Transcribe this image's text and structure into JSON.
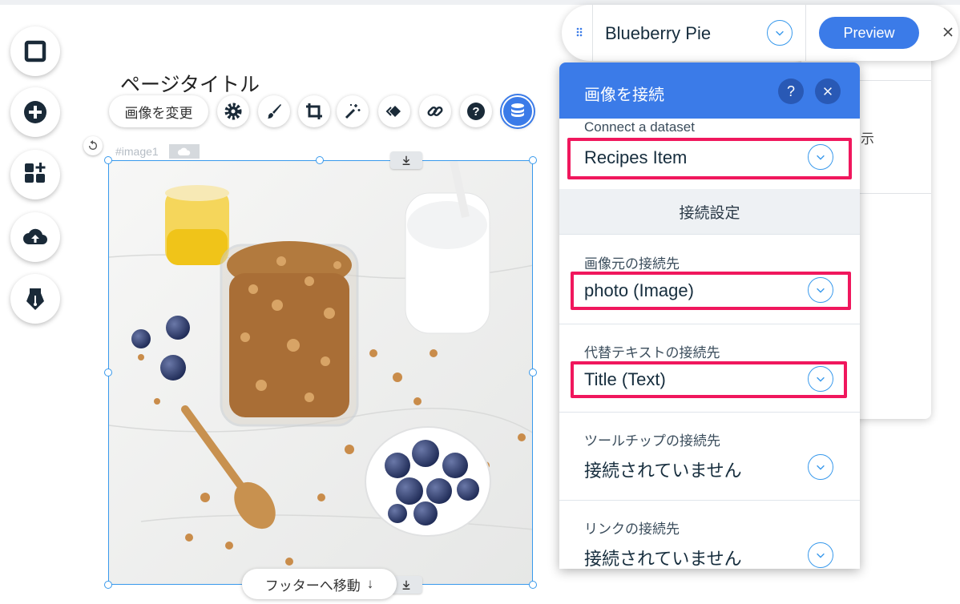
{
  "page_title": "ページタイトル",
  "toolbar": {
    "change_image_label": "画像を変更",
    "icons": [
      "gear-icon",
      "brush-icon",
      "crop-icon",
      "magic-wand-icon",
      "animation-icon",
      "link-icon",
      "help-icon",
      "database-icon"
    ]
  },
  "left_rail": [
    "square-icon",
    "plus-icon",
    "apps-icon",
    "cloud-upload-icon",
    "pen-icon"
  ],
  "element": {
    "id_label": "#image1",
    "footer_move_label": "フッターへ移動",
    "footer_move_arrow": "↓"
  },
  "header": {
    "page_name": "Blueberry Pie",
    "preview_label": "Preview",
    "close_glyph": "×"
  },
  "back_panel": {
    "ghost_text": "示"
  },
  "connect_panel": {
    "title": "画像を接続",
    "help_glyph": "?",
    "dataset_label": "Connect a dataset",
    "dataset_value": "Recipes Item",
    "section_heading": "接続設定",
    "fields": [
      {
        "label": "画像元の接続先",
        "value": "photo (Image)"
      },
      {
        "label": "代替テキストの接続先",
        "value": "Title (Text)"
      },
      {
        "label": "ツールチップの接続先",
        "value": "接続されていません"
      },
      {
        "label": "リンクの接続先",
        "value": "接続されていません"
      }
    ]
  },
  "colors": {
    "accent": "#3b7be8",
    "highlight": "#f0175d",
    "selection": "#3899ec"
  }
}
